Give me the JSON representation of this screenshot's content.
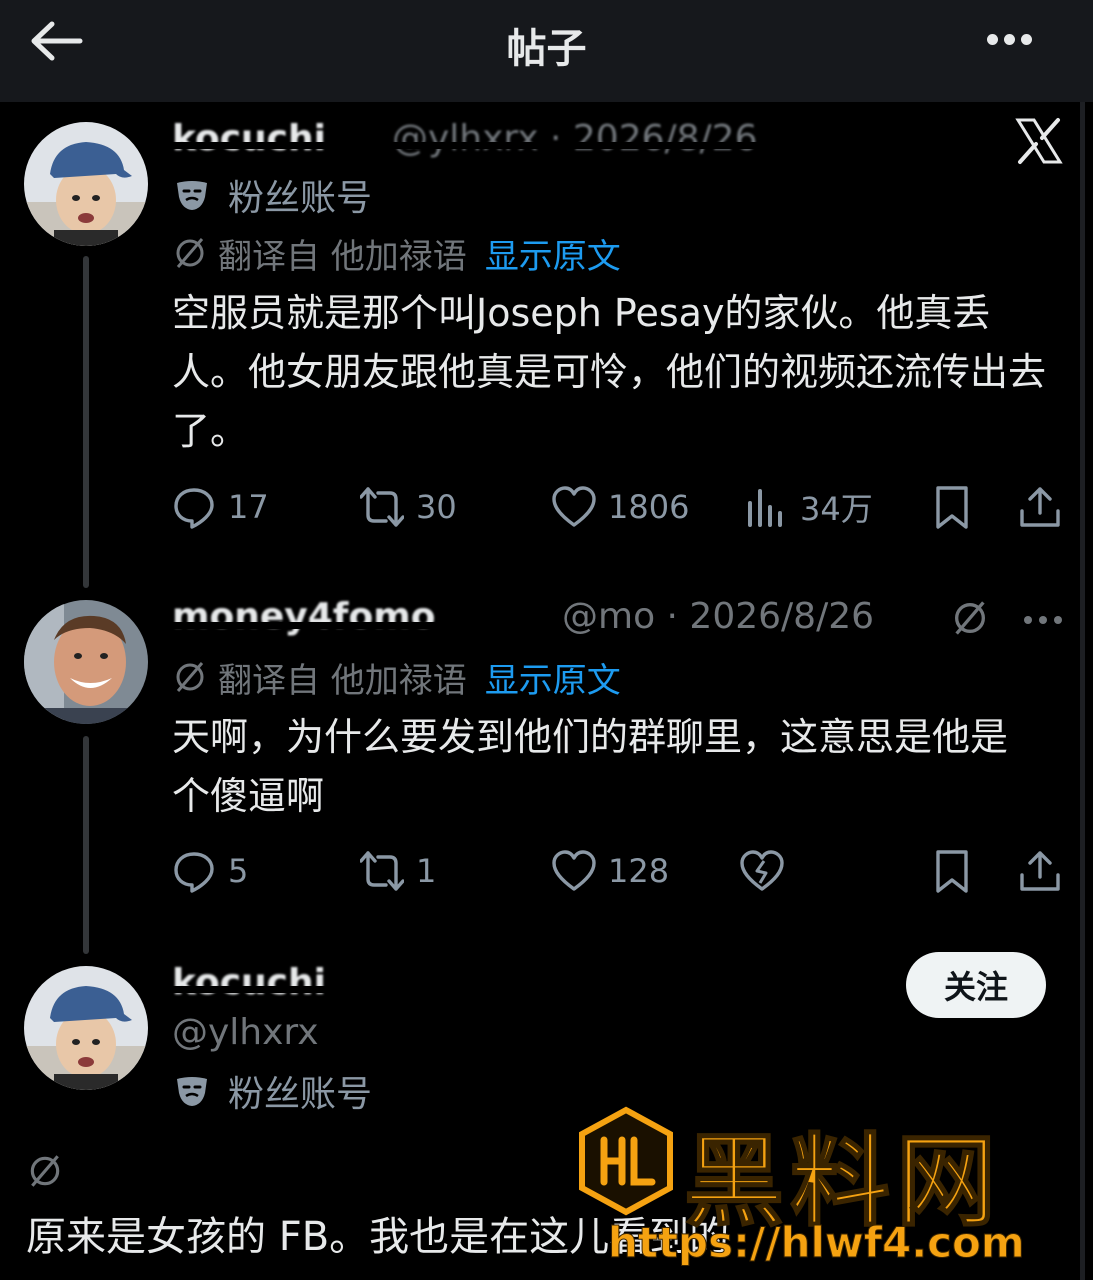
{
  "header": {
    "title": "帖子",
    "back_icon": "arrow-left-icon",
    "more_icon": "more-horizontal-icon"
  },
  "post1": {
    "name": "kocuchi",
    "handle_meta": "@ylhxrx · 2026/8/26",
    "fan_label": "粉丝账号",
    "translated_from": "翻译自 他加禄语",
    "show_original": "显示原文",
    "text": "空服员就是那个叫Joseph Pesay的家伙。他真丢人。他女朋友跟他真是可怜，他们的视频还流传出去了。",
    "stats": {
      "replies": "17",
      "reposts": "30",
      "likes": "1806",
      "views": "34万"
    }
  },
  "post2": {
    "name": "money4fomo",
    "handle_meta": "@mo · 2026/8/26",
    "translated_from": "翻译自 他加禄语",
    "show_original": "显示原文",
    "text": "天啊，为什么要发到他们的群聊里，这意思是他是个傻逼啊",
    "stats": {
      "replies": "5",
      "reposts": "1",
      "likes": "128"
    }
  },
  "post3": {
    "name": "kocuchi",
    "handle": "@ylhxrx",
    "fan_label": "粉丝账号",
    "follow_label": "关注",
    "text": "原来是女孩的 FB。我也是在这儿看到的"
  },
  "watermark": {
    "brand": "黑料网",
    "url": "https://hlwf4.com"
  },
  "colors": {
    "background": "#000000",
    "link": "#1d9bf0",
    "muted": "#71767b",
    "watermark": "#f5a211"
  }
}
